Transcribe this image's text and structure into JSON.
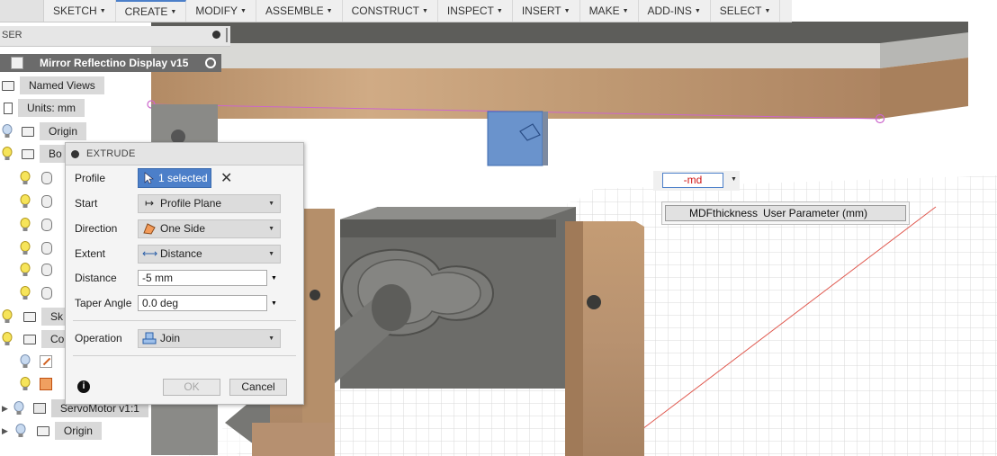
{
  "toolbar": {
    "items": [
      "SKETCH",
      "CREATE",
      "MODIFY",
      "ASSEMBLE",
      "CONSTRUCT",
      "INSPECT",
      "INSERT",
      "MAKE",
      "ADD-INS",
      "SELECT"
    ]
  },
  "browser": {
    "header_partial": "SER",
    "root_label": "Mirror Reflectino Display v15",
    "named_views": "Named Views",
    "units": "Units: mm",
    "origin": "Origin",
    "bodies_partial": "Bo",
    "sketches_partial": "Sk",
    "components_partial": "Co",
    "servo_label": "ServoMotor v1:1",
    "servo_origin": "Origin"
  },
  "extrude": {
    "title": "EXTRUDE",
    "profile_label": "Profile",
    "profile_value": "1 selected",
    "start_label": "Start",
    "start_value": "Profile Plane",
    "direction_label": "Direction",
    "direction_value": "One Side",
    "extent_label": "Extent",
    "extent_value": "Distance",
    "distance_label": "Distance",
    "distance_value": "-5 mm",
    "taper_label": "Taper Angle",
    "taper_value": "0.0 deg",
    "operation_label": "Operation",
    "operation_value": "Join",
    "ok_label": "OK",
    "cancel_label": "Cancel",
    "info_glyph": "i"
  },
  "canvas_input": {
    "value": "-md",
    "suggestion_name": "MDFthickness",
    "suggestion_type": "User Parameter (mm)"
  },
  "colors": {
    "accent_blue": "#4c7fc9",
    "selected_profile": "#6a93cc",
    "wood": "#c7a07a",
    "servo": "#6b6b68"
  }
}
